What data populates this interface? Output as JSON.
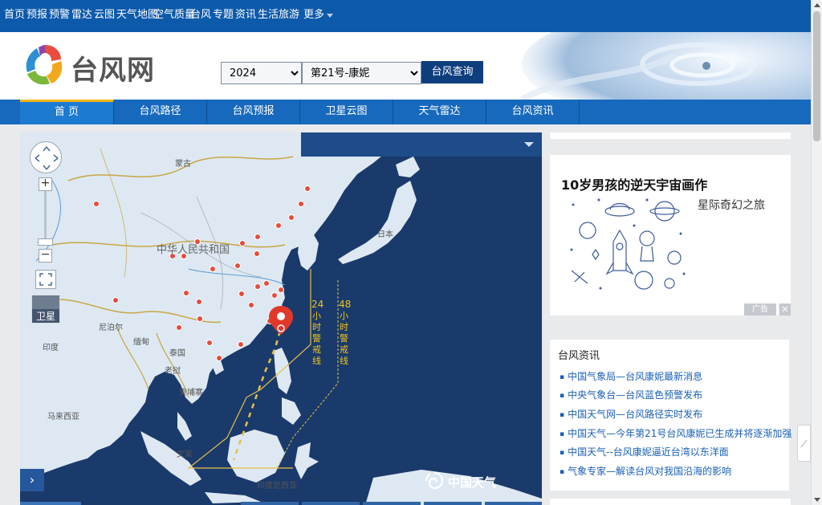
{
  "topnav": {
    "items": [
      "首页",
      "预报",
      "预警",
      "雷达",
      "云图",
      "天气地图",
      "空气质量",
      "台风",
      "专题",
      "资讯",
      "生活旅游"
    ],
    "more_label": "更多"
  },
  "header": {
    "logo_text": "台风网",
    "year_value": "2024",
    "storm_value": "第21号-康妮",
    "query_button": "台风查询"
  },
  "mainnav": {
    "tabs": [
      "首 页",
      "台风路径",
      "台风预报",
      "卫星云图",
      "天气雷达",
      "台风资讯"
    ],
    "active_index": 0
  },
  "map": {
    "country_labels": {
      "mongolia": "蒙古",
      "china": "中华人民共和国",
      "nepal": "尼泊尔",
      "myanmar": "缅甸",
      "laos": "老挝",
      "thailand": "泰国",
      "cambodia": "柬埔寨",
      "india": "印度",
      "japan": "日本",
      "malaysia": "马来西亚",
      "brunei": "文莱",
      "indonesia": "印度尼西亚"
    },
    "warning_line_24": "24小时警戒线",
    "warning_line_48": "48小时警戒线",
    "satellite_label": "卫星",
    "watermark": "中国天气",
    "expand_icon": "chevron-right-icon"
  },
  "ad": {
    "title": "10岁男孩的逆天宇宙画作",
    "side_text": "星际奇幻之旅",
    "label": "广告",
    "close": "✕"
  },
  "news": {
    "title": "台风资讯",
    "items": [
      "中国气象局—台风康妮最新消息",
      "中央气象台—台风蓝色预警发布",
      "中国天气网—台风路径实时发布",
      "中国天气—今年第21号台风康妮已生成并将逐渐加强",
      "中国天气--台风康妮逼近台湾以东洋面",
      "气象专家—解读台风对我国沿海的影响"
    ]
  },
  "colors": {
    "topnav": "#0d5aab",
    "mainnav": "#1769bd",
    "active_tab_border": "#f1b618",
    "ocean": "#1a3a6b",
    "land": "#dde8f2",
    "border_line": "#c9a646",
    "warning_line": "#e5c14a",
    "city_dot": "#e74c3c"
  }
}
